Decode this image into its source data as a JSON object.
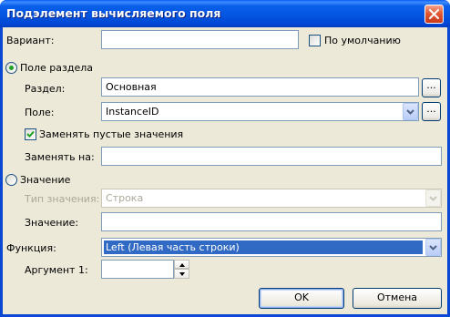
{
  "window": {
    "title": "Подэлемент вычисляемого поля"
  },
  "variant": {
    "label": "Вариант:",
    "value": ""
  },
  "default_checkbox": {
    "label": "По умолчанию",
    "checked": false
  },
  "field_section_radio": {
    "label": "Поле раздела",
    "selected": true
  },
  "section": {
    "label": "Раздел:",
    "value": "Основная",
    "browse_label": "..."
  },
  "field": {
    "label": "Поле:",
    "value": "InstanceID",
    "browse_label": "..."
  },
  "replace_empty_checkbox": {
    "label": "Заменять пустые значения",
    "checked": true
  },
  "replace_with": {
    "label": "Заменять на:",
    "value": ""
  },
  "value_radio": {
    "label": "Значение",
    "selected": false
  },
  "value_type": {
    "label": "Тип значения:",
    "value": "Строка"
  },
  "value_field": {
    "label": "Значение:",
    "value": ""
  },
  "function": {
    "label": "Функция:",
    "value": "Left (Левая часть строки)"
  },
  "argument1": {
    "label": "Аргумент 1:",
    "value": ""
  },
  "buttons": {
    "ok": "OK",
    "cancel": "Отмена"
  },
  "colors": {
    "title_bar": "#0054e3",
    "dialog_bg": "#ece9d8",
    "selection": "#316ac5",
    "radio_dot": "#21a121"
  }
}
